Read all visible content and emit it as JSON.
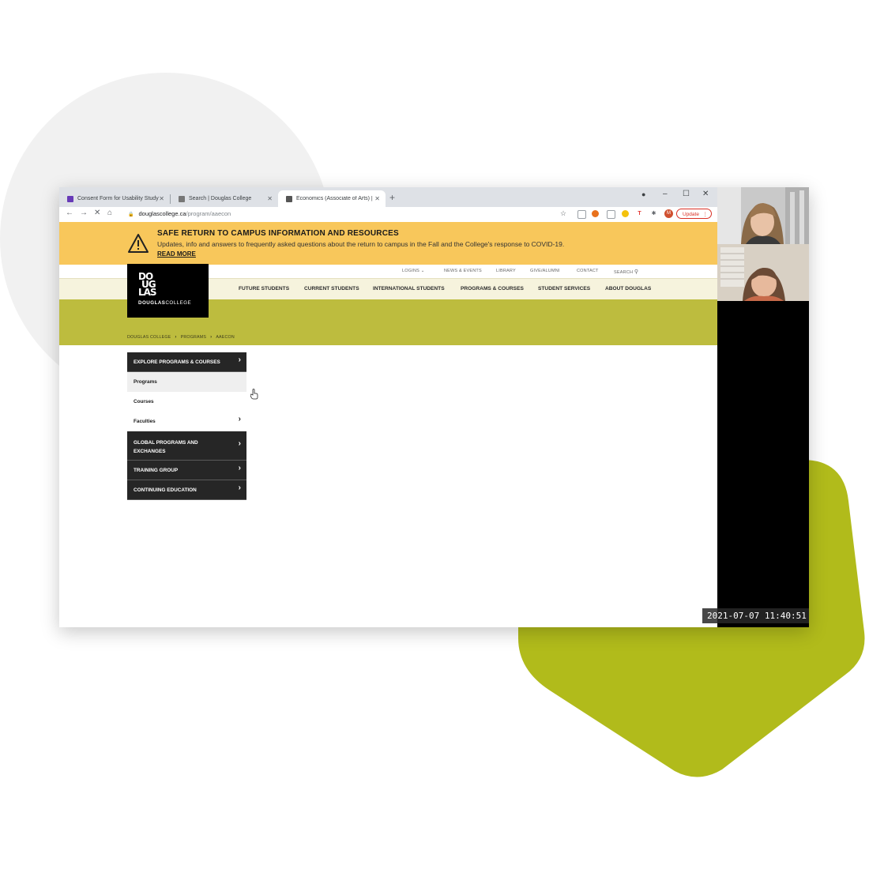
{
  "browser": {
    "tabs": [
      {
        "title": "Consent Form for Usability Study",
        "active": false
      },
      {
        "title": "Search | Douglas College",
        "active": false
      },
      {
        "title": "Economics (Associate of Arts) | D",
        "active": true
      }
    ],
    "new_tab_symbol": "+",
    "url_domain": "douglascollege.ca",
    "url_path": "/program/aaecon",
    "profile_initial": "M",
    "update_label": "Update"
  },
  "alert": {
    "title": "SAFE RETURN TO CAMPUS INFORMATION AND RESOURCES",
    "body": "Updates, info and answers to frequently asked questions about the return to campus in the Fall and the College's response to COVID-19.",
    "link": "READ MORE",
    "icon": "warning-triangle-icon",
    "background": "#f8c75b"
  },
  "utility_nav": {
    "logins": "LOGINS",
    "news": "NEWS & EVENTS",
    "library": "LIBRARY",
    "give": "GIVE/ALUMNI",
    "contact": "CONTACT",
    "search": "SEARCH"
  },
  "logo": {
    "mark": [
      "DO",
      "UG",
      "LAS"
    ],
    "text_bold": "DOUGLAS",
    "text_light": "COLLEGE"
  },
  "main_nav": [
    "FUTURE STUDENTS",
    "CURRENT STUDENTS",
    "INTERNATIONAL STUDENTS",
    "PROGRAMS & COURSES",
    "STUDENT SERVICES",
    "ABOUT DOUGLAS"
  ],
  "breadcrumb": [
    "DOUGLAS COLLEGE",
    "PROGRAMS",
    "AAECON"
  ],
  "side_nav": {
    "header": "EXPLORE PROGRAMS & COURSES",
    "subitems": [
      "Programs",
      "Courses",
      "Faculties"
    ],
    "sections": [
      [
        "GLOBAL PROGRAMS AND",
        "EXCHANGES"
      ],
      [
        "TRAINING GROUP"
      ],
      [
        "CONTINUING EDUCATION"
      ]
    ]
  },
  "recording": {
    "timestamp": "2021-07-07 11:40:51"
  },
  "colors": {
    "hero_green": "#bdbc3e",
    "decor_green": "#b1bb1b",
    "nav_cream": "#f6f3dd",
    "dark_nav": "#262626"
  }
}
